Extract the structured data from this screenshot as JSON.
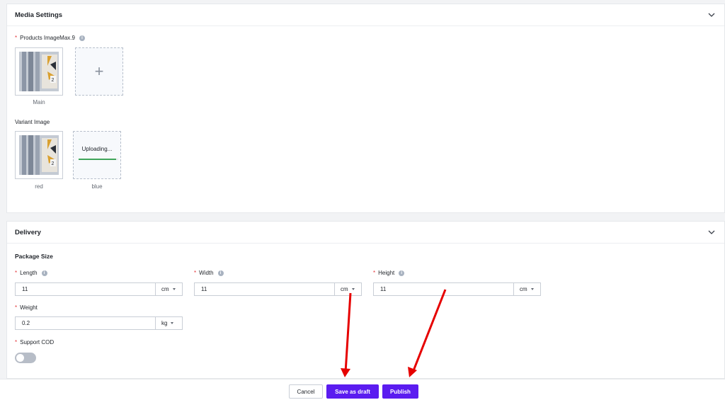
{
  "media": {
    "title": "Media Settings",
    "products_label": "Products ImageMax.9",
    "main_caption": "Main",
    "variant_label": "Variant Image",
    "variants": [
      {
        "caption": "red"
      },
      {
        "caption": "blue",
        "status": "Uploading...",
        "progress": 0.95
      }
    ],
    "add_symbol": "+"
  },
  "delivery": {
    "title": "Delivery",
    "package_size_label": "Package Size",
    "length": {
      "label": "Length",
      "value": "11",
      "unit": "cm"
    },
    "width": {
      "label": "Width",
      "value": "11",
      "unit": "cm"
    },
    "height": {
      "label": "Height",
      "value": "11",
      "unit": "cm"
    },
    "weight": {
      "label": "Weight",
      "value": "0.2",
      "unit": "kg"
    },
    "cod": {
      "label": "Support COD",
      "enabled": false
    }
  },
  "required_mark": "*",
  "info_symbol": "i",
  "footer": {
    "cancel_label": "Cancel",
    "draft_label": "Save as draft",
    "publish_label": "Publish"
  },
  "colors": {
    "primary": "#5b1cf0",
    "required": "#e4393c",
    "annotation_arrow": "#e60000"
  },
  "icons": {
    "collapse": "chevron-down-icon",
    "info": "info-icon",
    "dropdown": "caret-down-icon"
  }
}
